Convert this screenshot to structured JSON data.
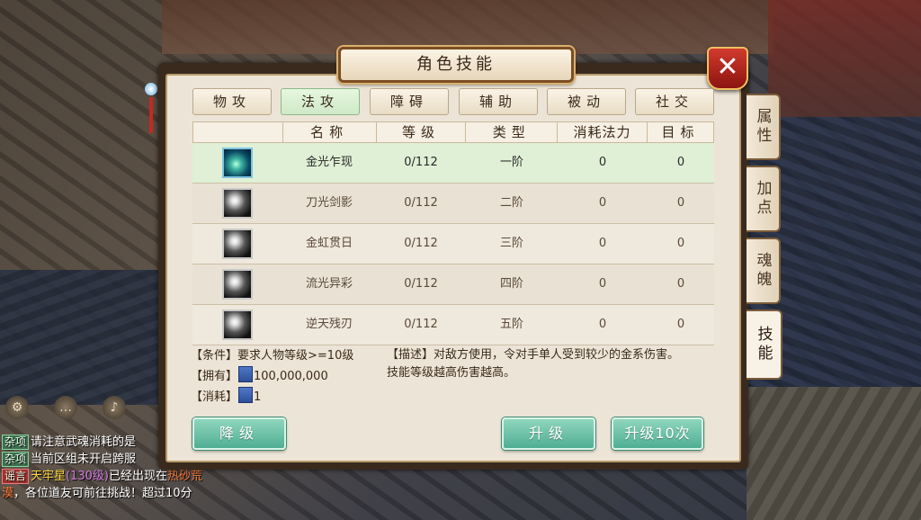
{
  "window": {
    "title": "角色技能",
    "close_label": "✕"
  },
  "tabs": [
    {
      "label": "物攻",
      "active": false
    },
    {
      "label": "法攻",
      "active": true
    },
    {
      "label": "障碍",
      "active": false
    },
    {
      "label": "辅助",
      "active": false
    },
    {
      "label": "被动",
      "active": false
    },
    {
      "label": "社交",
      "active": false
    }
  ],
  "side_tabs": [
    {
      "label": "属性",
      "active": false
    },
    {
      "label": "加点",
      "active": false
    },
    {
      "label": "魂魄",
      "active": false
    },
    {
      "label": "技能",
      "active": true
    }
  ],
  "table": {
    "headers": [
      "名称",
      "等级",
      "类型",
      "消耗法力",
      "目标"
    ],
    "rows": [
      {
        "icon": "golden-blade-skill-icon",
        "name": "金光乍现",
        "level": "0/112",
        "tier": "一阶",
        "mana": "0",
        "target": "0",
        "selected": true
      },
      {
        "icon": "sword-shadow-skill-icon",
        "name": "刀光剑影",
        "level": "0/112",
        "tier": "二阶",
        "mana": "0",
        "target": "0",
        "selected": false
      },
      {
        "icon": "rainbow-strike-skill-icon",
        "name": "金虹贯日",
        "level": "0/112",
        "tier": "三阶",
        "mana": "0",
        "target": "0",
        "selected": false
      },
      {
        "icon": "flowing-light-skill-icon",
        "name": "流光异彩",
        "level": "0/112",
        "tier": "四阶",
        "mana": "0",
        "target": "0",
        "selected": false
      },
      {
        "icon": "heaven-blade-skill-icon",
        "name": "逆天残刃",
        "level": "0/112",
        "tier": "五阶",
        "mana": "0",
        "target": "0",
        "selected": false
      }
    ]
  },
  "requirements": {
    "condition_label": "【条件】",
    "condition_text": "要求人物等级>=10级",
    "owned_label": "【拥有】",
    "owned_value": "100,000,000",
    "cost_label": "【消耗】",
    "cost_value": "1"
  },
  "description": {
    "label": "【描述】",
    "line1": "对敌方使用，令对手单人受到较少的金系伤害。",
    "line2": "技能等级越高伤害越高。"
  },
  "buttons": {
    "downgrade": "降级",
    "upgrade": "升级",
    "upgrade10": "升级10次"
  },
  "chat": {
    "lines": [
      {
        "tag": "杂项",
        "text": "请注意武魂消耗的是"
      },
      {
        "tag": "杂项",
        "text": "当前区组未开启跨服"
      },
      {
        "tag": "谣言",
        "seg1": "天牢星",
        "seg2": "(130级)",
        "seg3": "已经出现在",
        "seg4": "热砂荒"
      },
      {
        "text1": "漠",
        "text2": "，各位道友可前往挑战！超过10分"
      }
    ]
  },
  "colors": {
    "accent_green": "#4fae92",
    "selected_row": "#dff0d6",
    "close_red": "#c0281e"
  }
}
